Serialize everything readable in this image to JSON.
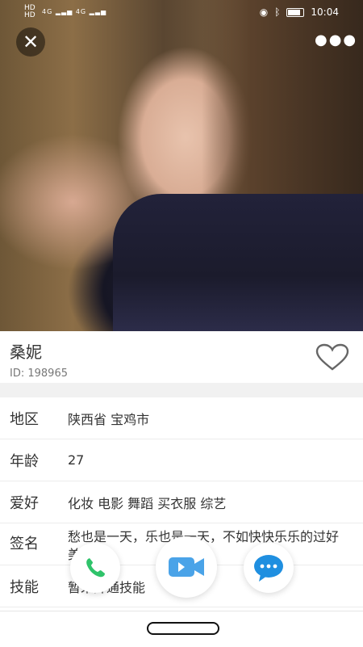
{
  "status_bar": {
    "left_badges": [
      "HD",
      "HD"
    ],
    "net_labels": [
      "4G",
      "4G"
    ],
    "time": "10:04"
  },
  "profile": {
    "name": "桑妮",
    "id_text": "ID: 198965"
  },
  "details": [
    {
      "label": "地区",
      "value": "陕西省 宝鸡市"
    },
    {
      "label": "年龄",
      "value": "27"
    },
    {
      "label": "爱好",
      "value": "化妆 电影 舞蹈 买衣服 综艺"
    },
    {
      "label": "签名",
      "value": "愁也是一天，乐也是一天，不如快快乐乐的过好美一天"
    },
    {
      "label": "技能",
      "value": "暂未开通技能"
    }
  ],
  "icons": {
    "close": "close-icon",
    "more": "more-icon",
    "heart": "heart-icon",
    "call": "phone-icon",
    "video": "video-camera-icon",
    "chat": "chat-bubble-icon"
  },
  "colors": {
    "call_green": "#2fc36a",
    "video_blue": "#4aa3e8",
    "chat_blue": "#1f8fe0"
  }
}
